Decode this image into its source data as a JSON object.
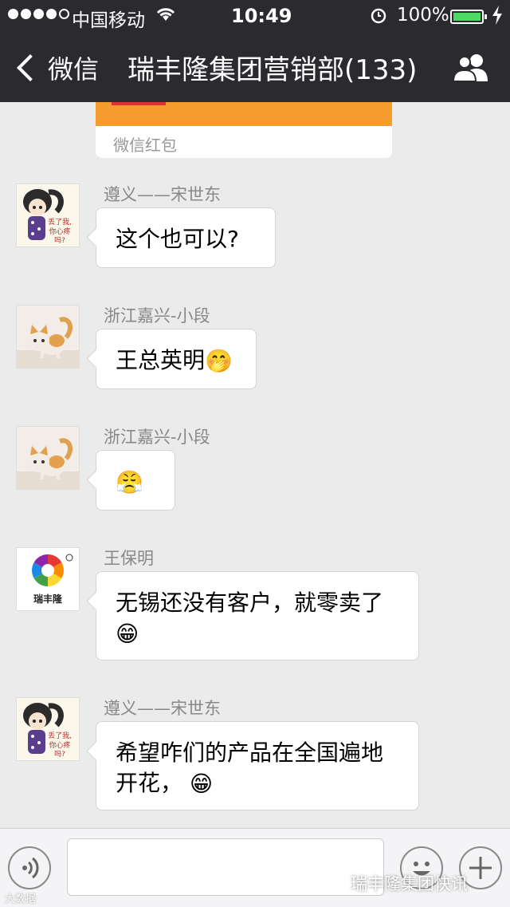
{
  "status_bar": {
    "carrier": "中国移动",
    "time": "10:49",
    "battery": "100%"
  },
  "nav": {
    "back_label": "微信",
    "title": "瑞丰隆集团营销部(133)"
  },
  "red_packet": {
    "label": "微信红包"
  },
  "messages": [
    {
      "sender": "遵义——宋世东",
      "text": "这个也可以?",
      "avatar": "cartoon-girl-avatar"
    },
    {
      "sender": "浙江嘉兴-小段",
      "text": "王总英明",
      "emoji": "🤭",
      "avatar": "kitten-avatar"
    },
    {
      "sender": "浙江嘉兴-小段",
      "emoji": "😤",
      "avatar": "kitten-avatar"
    },
    {
      "sender": "王保明",
      "text": "无锡还没有客户，就零卖了",
      "emoji": "😁",
      "avatar": "ruifenglong-logo-avatar",
      "logo_text": "瑞丰隆"
    },
    {
      "sender": "遵义——宋世东",
      "text": "希望咋们的产品在全国遍地",
      "text2": "开花，",
      "emoji": "😁",
      "avatar": "cartoon-girl-avatar"
    }
  ],
  "watermark": {
    "left": "大数据",
    "right": "瑞丰隆集团快讯"
  },
  "colors": {
    "nav_bg": "#2a2a2f",
    "chat_bg": "#ebebeb",
    "red_packet": "#f79d2f",
    "battery": "#4cd964"
  }
}
